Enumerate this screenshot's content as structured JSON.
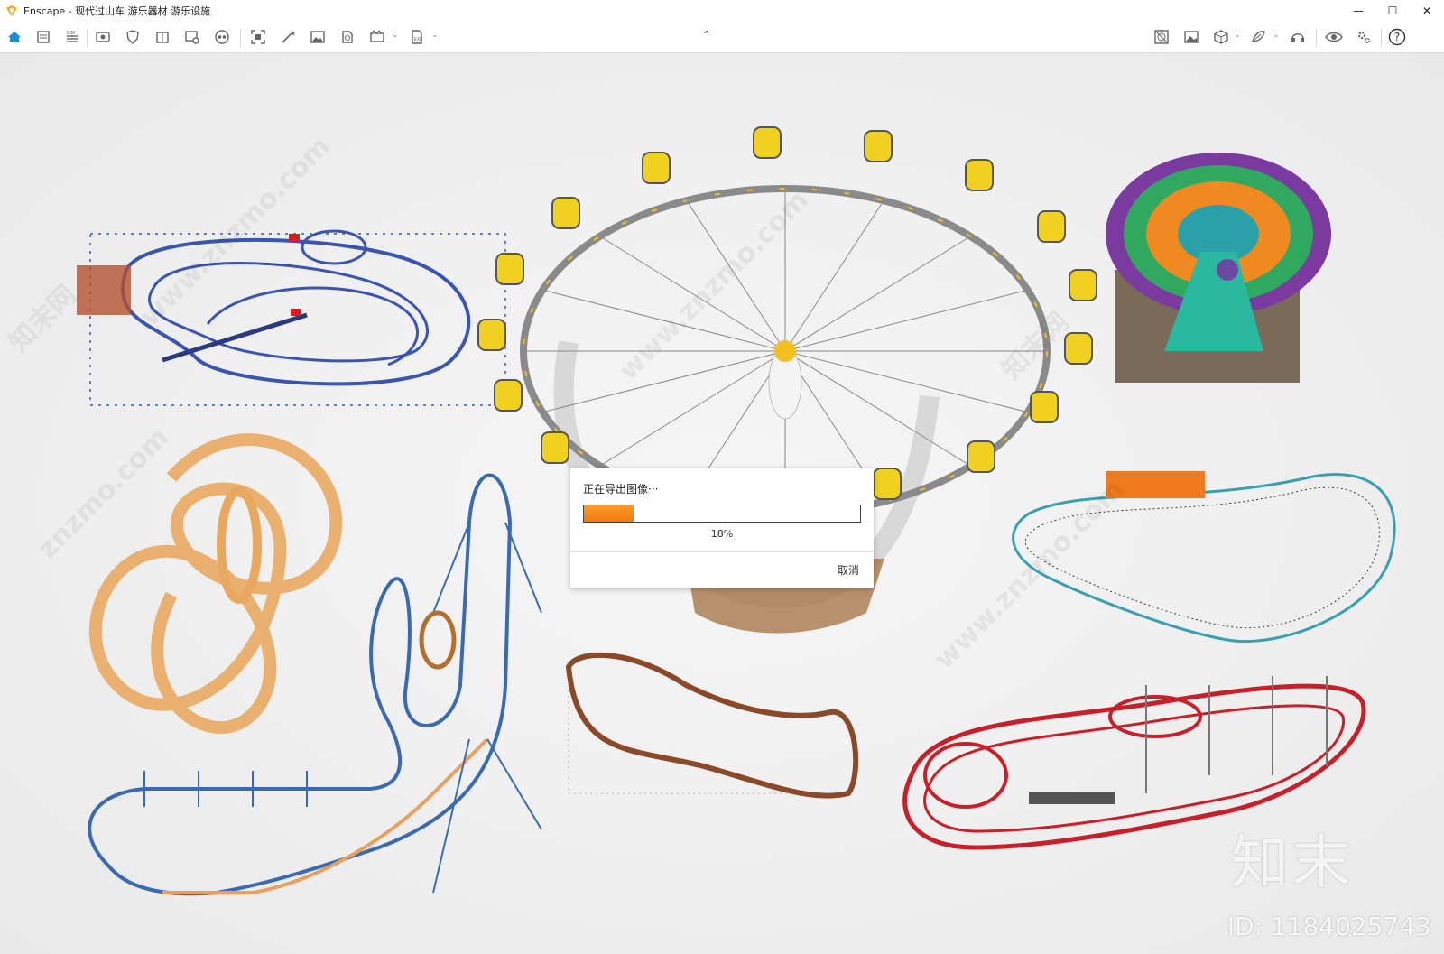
{
  "window": {
    "app_name": "Enscape",
    "title": "Enscape - 现代过山车 游乐器材 游乐设施",
    "controls": {
      "minimize": "—",
      "maximize": "☐",
      "close": "✕"
    }
  },
  "toolbar": {
    "left_icons": [
      "home-icon",
      "notes-icon",
      "bim-icon",
      "view-icon",
      "shield-icon",
      "building-icon",
      "image-gallery-icon",
      "vr-icon",
      "screenshot-icon",
      "magic-wand-icon",
      "render-image-icon",
      "panorama-icon",
      "video-icon",
      "export-icon"
    ],
    "collapse_glyph": "⌃",
    "right_icons": [
      "material-editor-icon",
      "landscape-icon",
      "asset-library-icon",
      "site-context-icon",
      "headset-icon",
      "visual-settings-icon",
      "general-settings-icon",
      "help-icon"
    ],
    "help_label": "?"
  },
  "export_dialog": {
    "title": "正在导出图像···",
    "progress": 0.18,
    "progress_text": "18%",
    "cancel_label": "取消"
  },
  "watermarks": [
    "www.znzmo.com",
    "知末网",
    "www.znzmo.com",
    "知末网",
    "znzmo.com",
    "www.znzmo.com"
  ],
  "branding": {
    "logo_text": "知末",
    "image_id": "ID: 1184025743"
  },
  "colors": {
    "accent": "#1a8cd8",
    "progress": "#f58a1f",
    "track_blue": "#3a55b0",
    "track_red": "#c8202a",
    "track_orange": "#e8a860"
  }
}
